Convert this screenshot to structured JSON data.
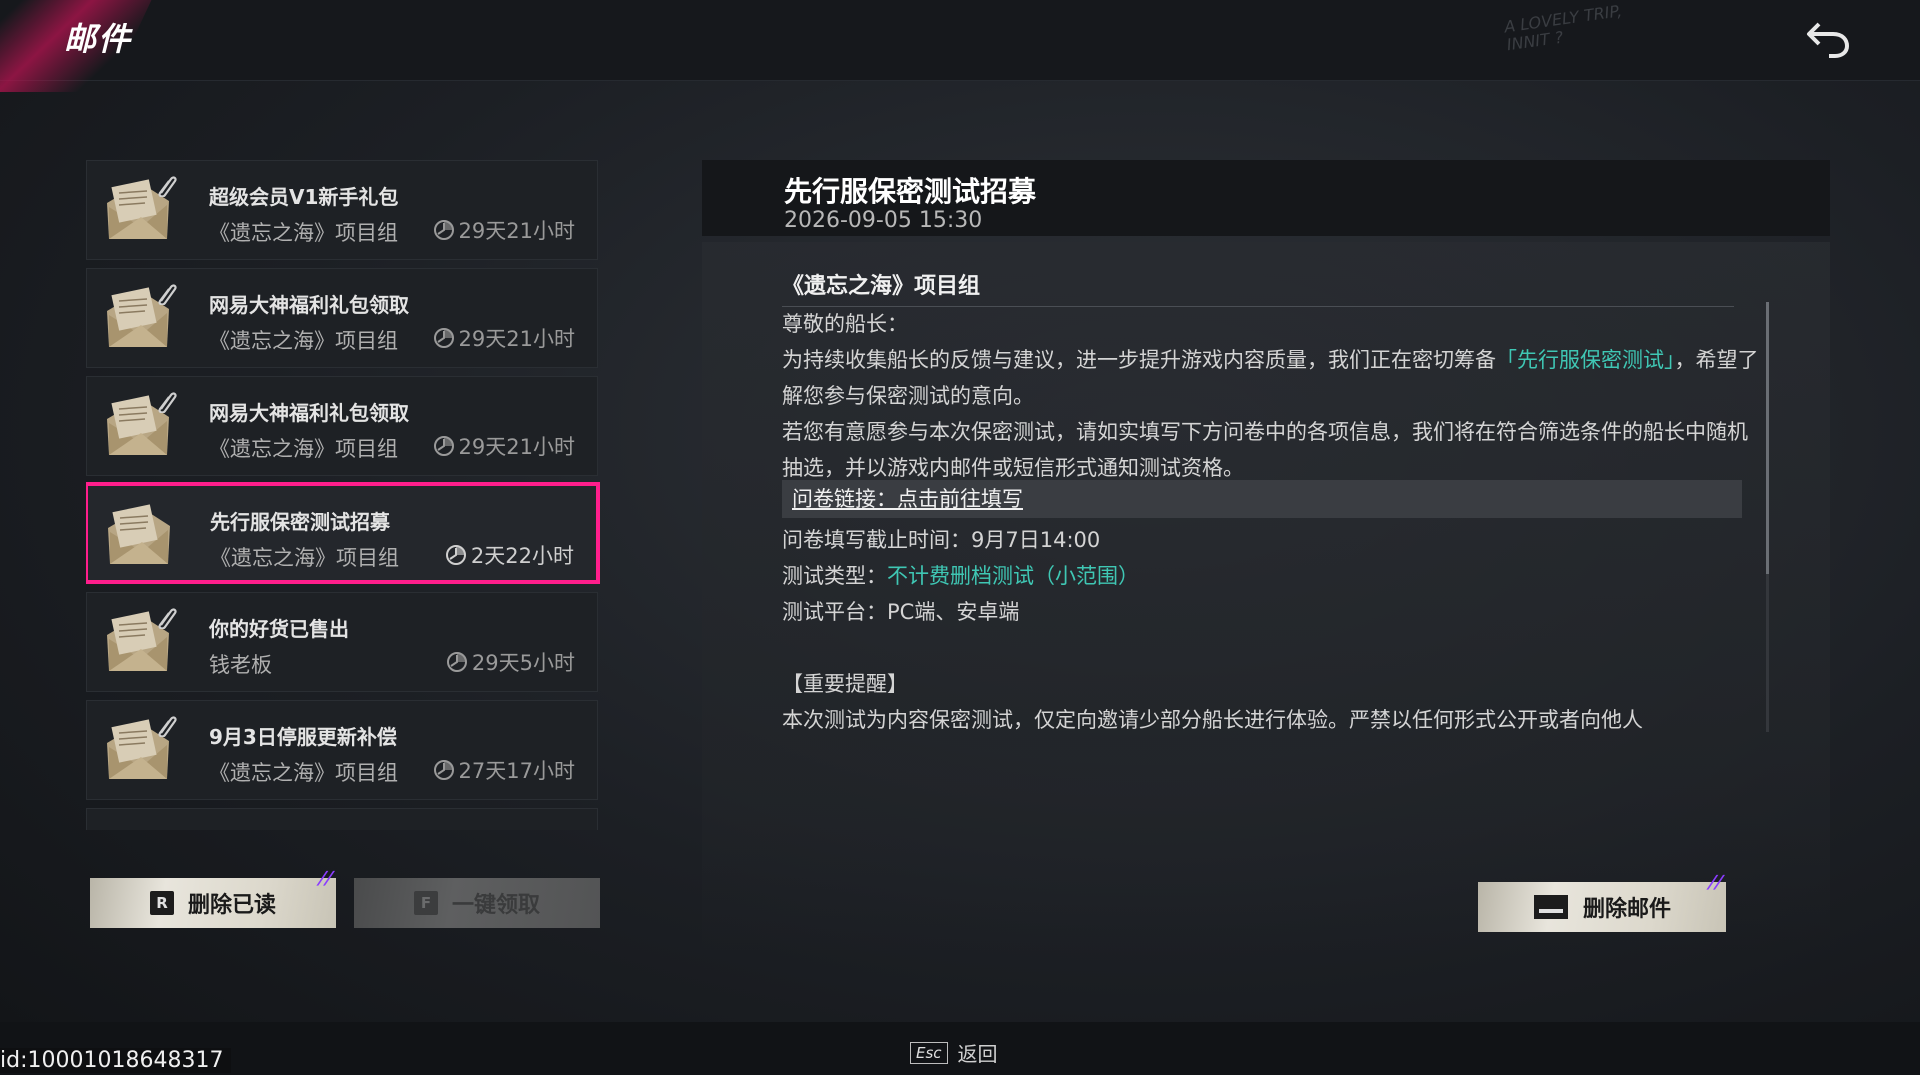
{
  "header": {
    "title": "邮件",
    "watermark": "A LOVELY TRIP, INNIT ?"
  },
  "mail_list": [
    {
      "subject": "超级会员V1新手礼包",
      "sender": "《遗忘之海》项目组",
      "time_left": "29天21小时",
      "attachment": true,
      "selected": false
    },
    {
      "subject": "网易大神福利礼包领取",
      "sender": "《遗忘之海》项目组",
      "time_left": "29天21小时",
      "attachment": true,
      "selected": false
    },
    {
      "subject": "网易大神福利礼包领取",
      "sender": "《遗忘之海》项目组",
      "time_left": "29天21小时",
      "attachment": true,
      "selected": false
    },
    {
      "subject": "先行服保密测试招募",
      "sender": "《遗忘之海》项目组",
      "time_left": "2天22小时",
      "attachment": false,
      "selected": true
    },
    {
      "subject": "你的好货已售出",
      "sender": "钱老板",
      "time_left": "29天5小时",
      "attachment": true,
      "selected": false
    },
    {
      "subject": "9月3日停服更新补偿",
      "sender": "《遗忘之海》项目组",
      "time_left": "27天17小时",
      "attachment": true,
      "selected": false
    }
  ],
  "buttons": {
    "delete_read": {
      "key": "R",
      "label": "删除已读"
    },
    "claim_all": {
      "key": "F",
      "label": "一键领取"
    },
    "delete_mail": {
      "label": "删除邮件"
    }
  },
  "detail": {
    "title": "先行服保密测试招募",
    "date": "2026-09-05 15:30",
    "sender": "《遗忘之海》项目组",
    "greeting": "尊敬的船长：",
    "p1_before": "为持续收集船长的反馈与建议，进一步提升游戏内容质量，我们正在密切筹备",
    "p1_accent": "「先行服保密测试」",
    "p1_after": "，希望了解您参与保密测试的意向。",
    "p2": "若您有意愿参与本次保密测试，请如实填写下方问卷中的各项信息，我们将在符合筛选条件的船长中随机抽选，并以游戏内邮件或短信形式通知测试资格。",
    "link": "问卷链接：点击前往填写",
    "deadline": "问卷填写截止时间：9月7日14:00",
    "type_label": "测试类型：",
    "type_value": "不计费删档测试（小范围）",
    "platform": "测试平台：PC端、安卓端",
    "notice_title": "【重要提醒】",
    "notice": "本次测试为内容保密测试，仅定向邀请少部分船长进行体验。严禁以任何形式公开或者向他人"
  },
  "footer": {
    "esc_key": "Esc",
    "back_label": "返回",
    "user_id": "id:10001018648317"
  },
  "colors": {
    "accent_pink": "#ff1e8c",
    "accent_teal": "#3fc7b4"
  }
}
